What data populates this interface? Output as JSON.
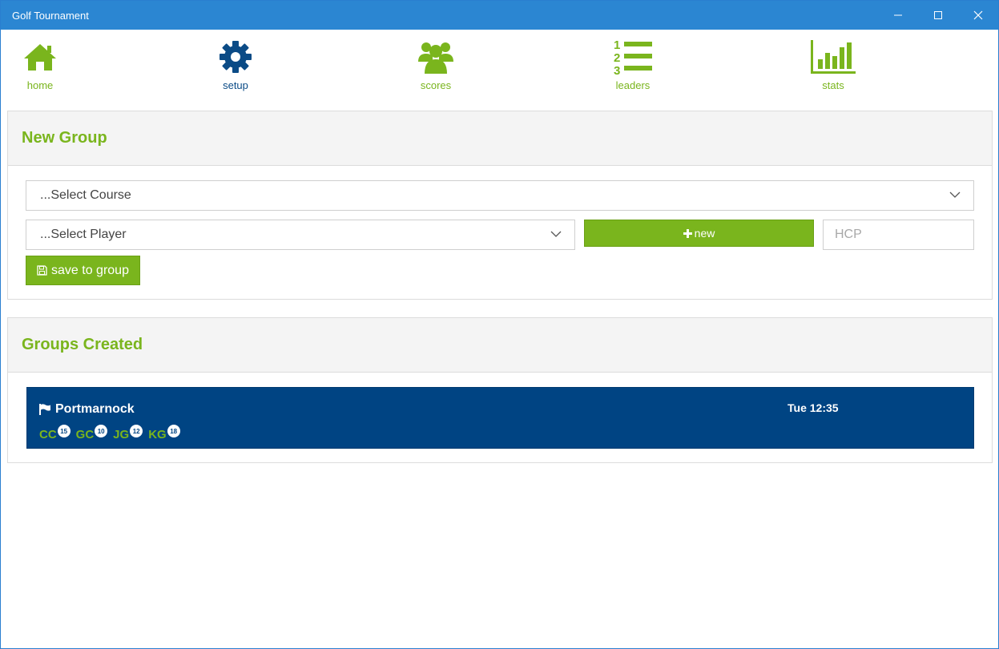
{
  "window": {
    "title": "Golf Tournament"
  },
  "nav": [
    {
      "label": "home",
      "icon": "home-icon",
      "color": "#7ab51d"
    },
    {
      "label": "setup",
      "icon": "gear-icon",
      "color": "#0b4b86"
    },
    {
      "label": "scores",
      "icon": "users-icon",
      "color": "#7ab51d"
    },
    {
      "label": "leaders",
      "icon": "numbered-list-icon",
      "color": "#7ab51d"
    },
    {
      "label": "stats",
      "icon": "bar-chart-icon",
      "color": "#7ab51d"
    }
  ],
  "new_group": {
    "title": "New Group",
    "course_select": "...Select Course",
    "player_select": "...Select Player",
    "new_button": "new",
    "hcp_placeholder": "HCP",
    "save_button": "save to group"
  },
  "groups_created": {
    "title": "Groups Created",
    "groups": [
      {
        "name": "Portmarnock",
        "time": "Tue 12:35",
        "players": [
          {
            "initials": "CC",
            "hcp": "15"
          },
          {
            "initials": "GC",
            "hcp": "10"
          },
          {
            "initials": "JG",
            "hcp": "12"
          },
          {
            "initials": "KG",
            "hcp": "18"
          }
        ]
      }
    ]
  },
  "colors": {
    "accent_green": "#7ab51d",
    "navy": "#004483",
    "titlebar": "#2b86d2"
  }
}
